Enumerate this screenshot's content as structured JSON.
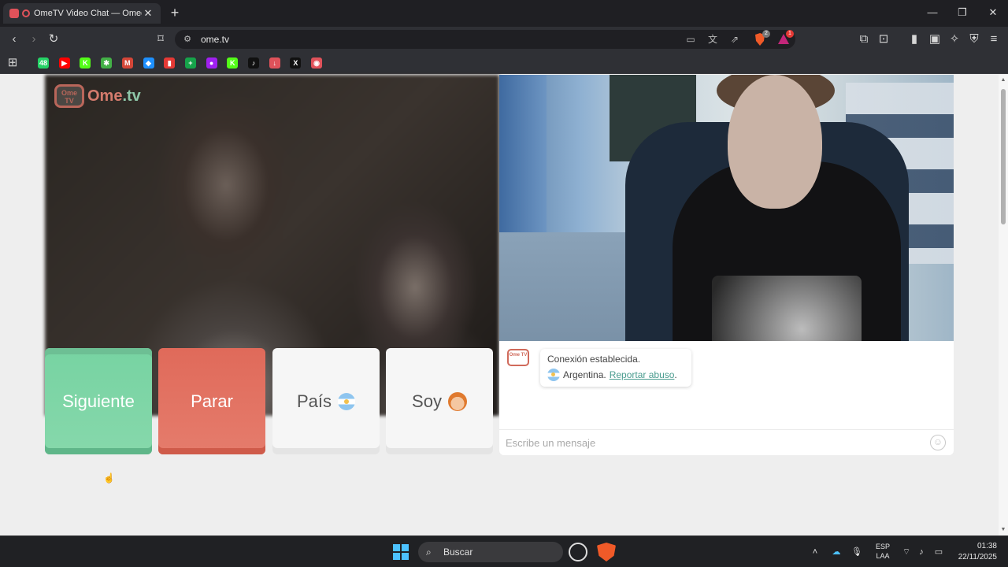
{
  "browser": {
    "tab_title": "OmeTV Video Chat — Omegl",
    "new_tab_icon": "plus-icon",
    "url": "ome.tv",
    "window_controls": [
      "minimize",
      "maximize",
      "close"
    ],
    "shield_badge": "2",
    "alert_badge": "1"
  },
  "bookmarks": [
    {
      "name": "bookmark-whatsapp",
      "label": "48",
      "color": "#25d366"
    },
    {
      "name": "bookmark-youtube",
      "label": "▶",
      "color": "#ff0000"
    },
    {
      "name": "bookmark-kick",
      "label": "K",
      "color": "#53fc18"
    },
    {
      "name": "bookmark-green",
      "label": "✱",
      "color": "#43b047"
    },
    {
      "name": "bookmark-gmail",
      "label": "M",
      "color": "#d44638"
    },
    {
      "name": "bookmark-blue",
      "label": "◆",
      "color": "#1e90ff"
    },
    {
      "name": "bookmark-chart",
      "label": "▮",
      "color": "#e53935"
    },
    {
      "name": "bookmark-sheet",
      "label": "+",
      "color": "#16a34a"
    },
    {
      "name": "bookmark-purple",
      "label": "●",
      "color": "#a020f0"
    },
    {
      "name": "bookmark-kick-2",
      "label": "K",
      "color": "#53fc18"
    },
    {
      "name": "bookmark-tiktok",
      "label": "♪",
      "color": "#111111"
    },
    {
      "name": "bookmark-download",
      "label": "↓",
      "color": "#e0525a"
    },
    {
      "name": "bookmark-x",
      "label": "X",
      "color": "#111111"
    },
    {
      "name": "bookmark-shield",
      "label": "◉",
      "color": "#e0525a"
    }
  ],
  "page": {
    "logo_text": "Ome",
    "logo_dot": ".tv",
    "logo_badge": "Ome TV",
    "buttons": {
      "next": "Siguiente",
      "stop": "Parar",
      "country": "País",
      "soy": "Soy"
    },
    "chat": {
      "status_line": "Conexión establecida.",
      "country": "Argentina.",
      "report_link": "Reportar abuso",
      "period": ".",
      "input_placeholder": "Escribe un mensaje"
    }
  },
  "taskbar": {
    "search_label": "Buscar",
    "lang_line1": "ESP",
    "lang_line2": "LAA",
    "time": "01:38",
    "date": "22/11/2025"
  },
  "colors": {
    "next_button": "#77d3a2",
    "stop_button": "#e06a5a",
    "link": "#4a9c8f"
  }
}
